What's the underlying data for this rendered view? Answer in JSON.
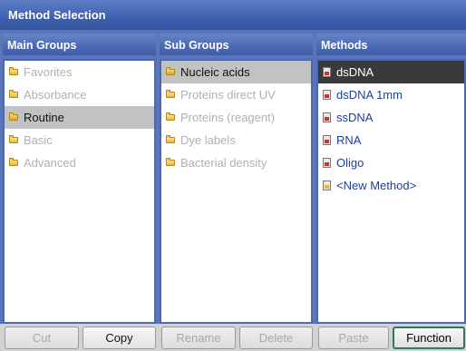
{
  "window": {
    "title": "Method Selection"
  },
  "columns": {
    "main_groups": {
      "header": "Main Groups",
      "items": [
        {
          "label": "Favorites",
          "state": "dim"
        },
        {
          "label": "Absorbance",
          "state": "dim"
        },
        {
          "label": "Routine",
          "state": "selected"
        },
        {
          "label": "Basic",
          "state": "dim"
        },
        {
          "label": "Advanced",
          "state": "dim"
        }
      ]
    },
    "sub_groups": {
      "header": "Sub Groups",
      "items": [
        {
          "label": "Nucleic acids",
          "state": "selected"
        },
        {
          "label": "Proteins direct UV",
          "state": "dim"
        },
        {
          "label": "Proteins (reagent)",
          "state": "dim"
        },
        {
          "label": "Dye labels",
          "state": "dim"
        },
        {
          "label": "Bacterial density",
          "state": "dim"
        }
      ]
    },
    "methods": {
      "header": "Methods",
      "items": [
        {
          "label": "dsDNA",
          "state": "highlighted",
          "icon": "method-icon"
        },
        {
          "label": "dsDNA 1mm",
          "state": "normal",
          "icon": "method-icon"
        },
        {
          "label": "ssDNA",
          "state": "normal",
          "icon": "method-icon"
        },
        {
          "label": "RNA",
          "state": "normal",
          "icon": "method-icon"
        },
        {
          "label": "Oligo",
          "state": "normal",
          "icon": "method-icon"
        },
        {
          "label": "<New Method>",
          "state": "normal",
          "icon": "new-method-icon"
        }
      ]
    }
  },
  "buttons": {
    "cut": "Cut",
    "copy": "Copy",
    "rename": "Rename",
    "delete": "Delete",
    "paste": "Paste",
    "function": "Function"
  },
  "colors": {
    "accent": "#4c69b3",
    "selection": "#c2c2c2",
    "highlight": "#3a3a3a",
    "link_text": "#1b3f9a"
  }
}
